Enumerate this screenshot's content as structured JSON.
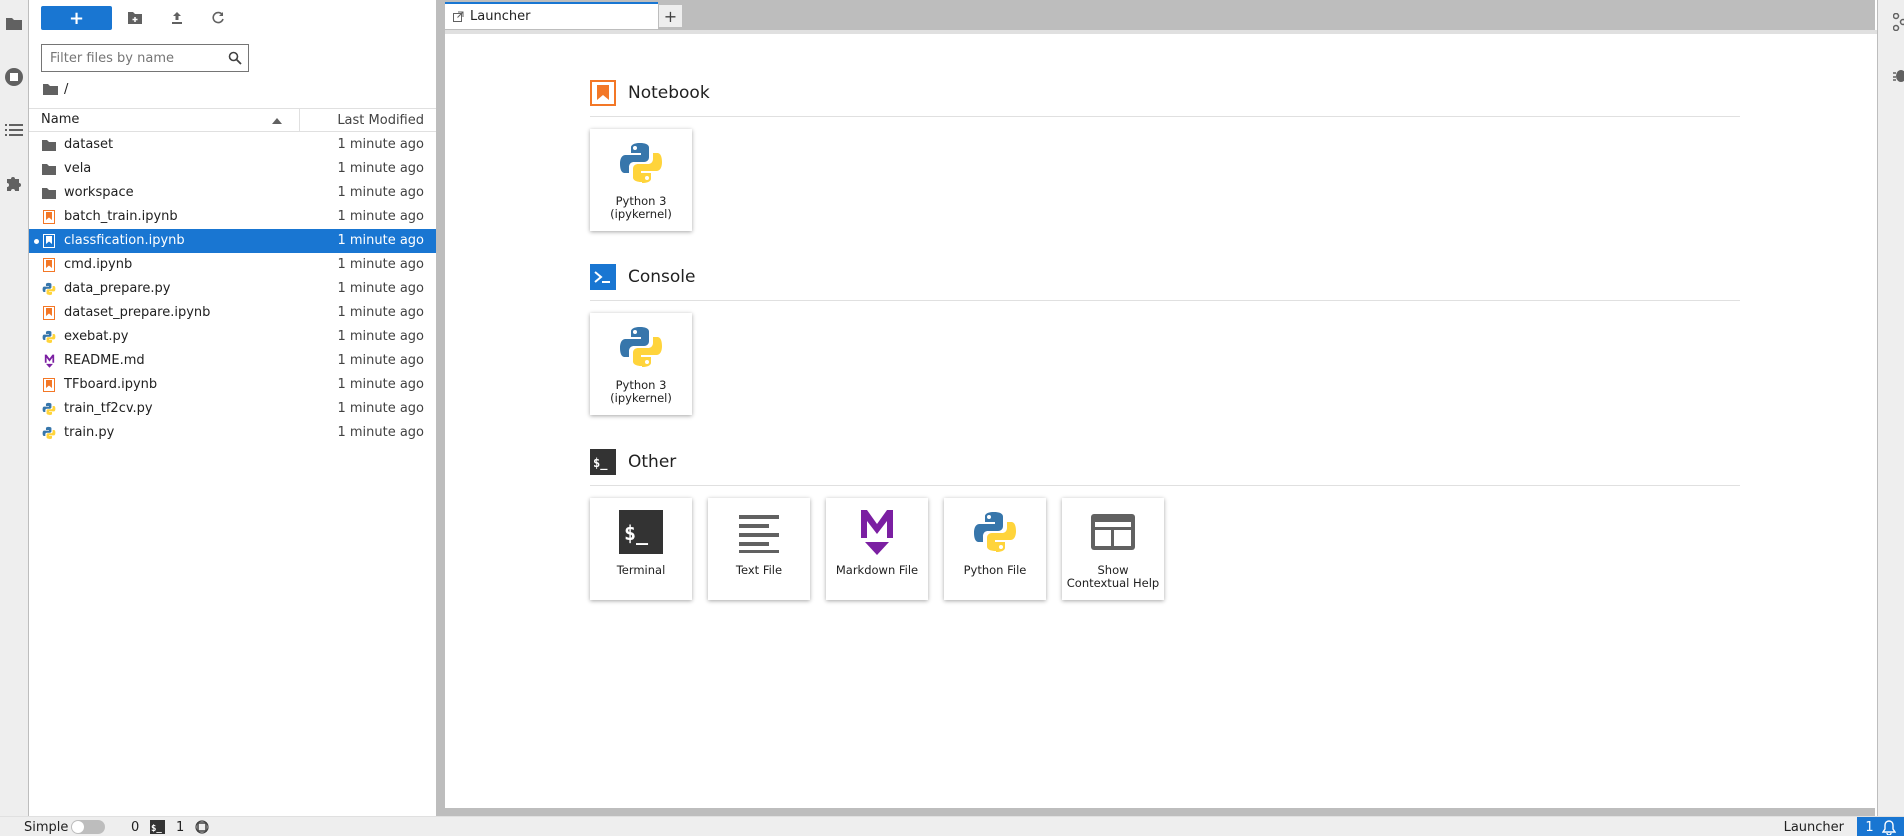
{
  "activity_bar": {
    "items": [
      {
        "icon": "folder-icon"
      },
      {
        "icon": "running-stop-icon"
      },
      {
        "icon": "toc-list-icon"
      },
      {
        "icon": "extension-puzzle-icon"
      }
    ]
  },
  "file_browser": {
    "new_launcher_label": "+",
    "filter_placeholder": "Filter files by name",
    "breadcrumb": "/",
    "header": {
      "name": "Name",
      "modified": "Last Modified"
    },
    "files": [
      {
        "name": "dataset",
        "type": "folder",
        "modified": "1 minute ago"
      },
      {
        "name": "vela",
        "type": "folder",
        "modified": "1 minute ago"
      },
      {
        "name": "workspace",
        "type": "folder",
        "modified": "1 minute ago"
      },
      {
        "name": "batch_train.ipynb",
        "type": "notebook",
        "modified": "1 minute ago"
      },
      {
        "name": "classfication.ipynb",
        "type": "notebook",
        "modified": "1 minute ago",
        "selected": true
      },
      {
        "name": "cmd.ipynb",
        "type": "notebook",
        "modified": "1 minute ago"
      },
      {
        "name": "data_prepare.py",
        "type": "python",
        "modified": "1 minute ago"
      },
      {
        "name": "dataset_prepare.ipynb",
        "type": "notebook",
        "modified": "1 minute ago"
      },
      {
        "name": "exebat.py",
        "type": "python",
        "modified": "1 minute ago"
      },
      {
        "name": "README.md",
        "type": "markdown",
        "modified": "1 minute ago"
      },
      {
        "name": "TFboard.ipynb",
        "type": "notebook",
        "modified": "1 minute ago"
      },
      {
        "name": "train_tf2cv.py",
        "type": "python",
        "modified": "1 minute ago"
      },
      {
        "name": "train.py",
        "type": "python",
        "modified": "1 minute ago"
      }
    ]
  },
  "tabs": [
    {
      "label": "Launcher"
    }
  ],
  "add_tab_label": "+",
  "launcher": {
    "notebook": {
      "title": "Notebook",
      "cards": [
        {
          "label": "Python 3\n(ipykernel)"
        }
      ]
    },
    "console": {
      "title": "Console",
      "cards": [
        {
          "label": "Python 3\n(ipykernel)"
        }
      ]
    },
    "other": {
      "title": "Other",
      "cards": [
        {
          "label": "Terminal"
        },
        {
          "label": "Text File"
        },
        {
          "label": "Markdown File"
        },
        {
          "label": "Python File"
        },
        {
          "label": "Show\nContextual Help"
        }
      ]
    }
  },
  "status_bar": {
    "mode_label": "Simple",
    "terminals_count": "0",
    "kernels_count": "1",
    "right_label": "Launcher",
    "notifications_count": "1"
  },
  "colors": {
    "accent": "#1976d2",
    "notebook_orange": "#f37726",
    "markdown_purple": "#7b1fa2"
  }
}
